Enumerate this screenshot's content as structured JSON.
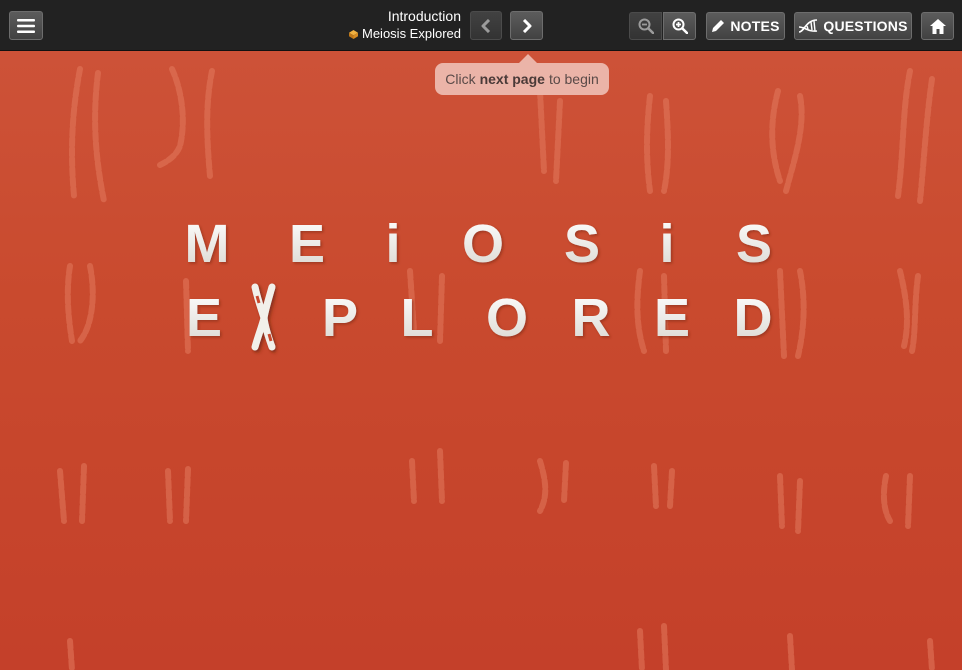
{
  "toolbar": {
    "section_title": "Introduction",
    "module_title": "Meiosis Explored",
    "notes_label": "NOTES",
    "questions_label": "QUESTIONS",
    "icons": {
      "menu": "hamburger-menu-icon",
      "prev": "chevron-left-icon",
      "next": "chevron-right-icon",
      "zoom_out": "zoom-out-icon",
      "zoom_in": "zoom-in-icon",
      "notes": "pencil-icon",
      "questions": "dna-icon",
      "home": "home-icon",
      "module": "module-icon"
    }
  },
  "tooltip": {
    "prefix": "Click",
    "bold": "next page",
    "suffix": "to begin"
  },
  "main": {
    "title_line1": [
      "M",
      "E",
      "i",
      "O",
      "S",
      "i",
      "S"
    ],
    "title_line2": [
      "E",
      "X",
      "P",
      "L",
      "O",
      "R",
      "E",
      "D"
    ]
  },
  "colors": {
    "background": "#c94a2e",
    "toolbar": "#222222",
    "tooltip_bg": "#ebb4a8",
    "title_text": "#ecebe6",
    "module_icon": "#e09a30"
  }
}
